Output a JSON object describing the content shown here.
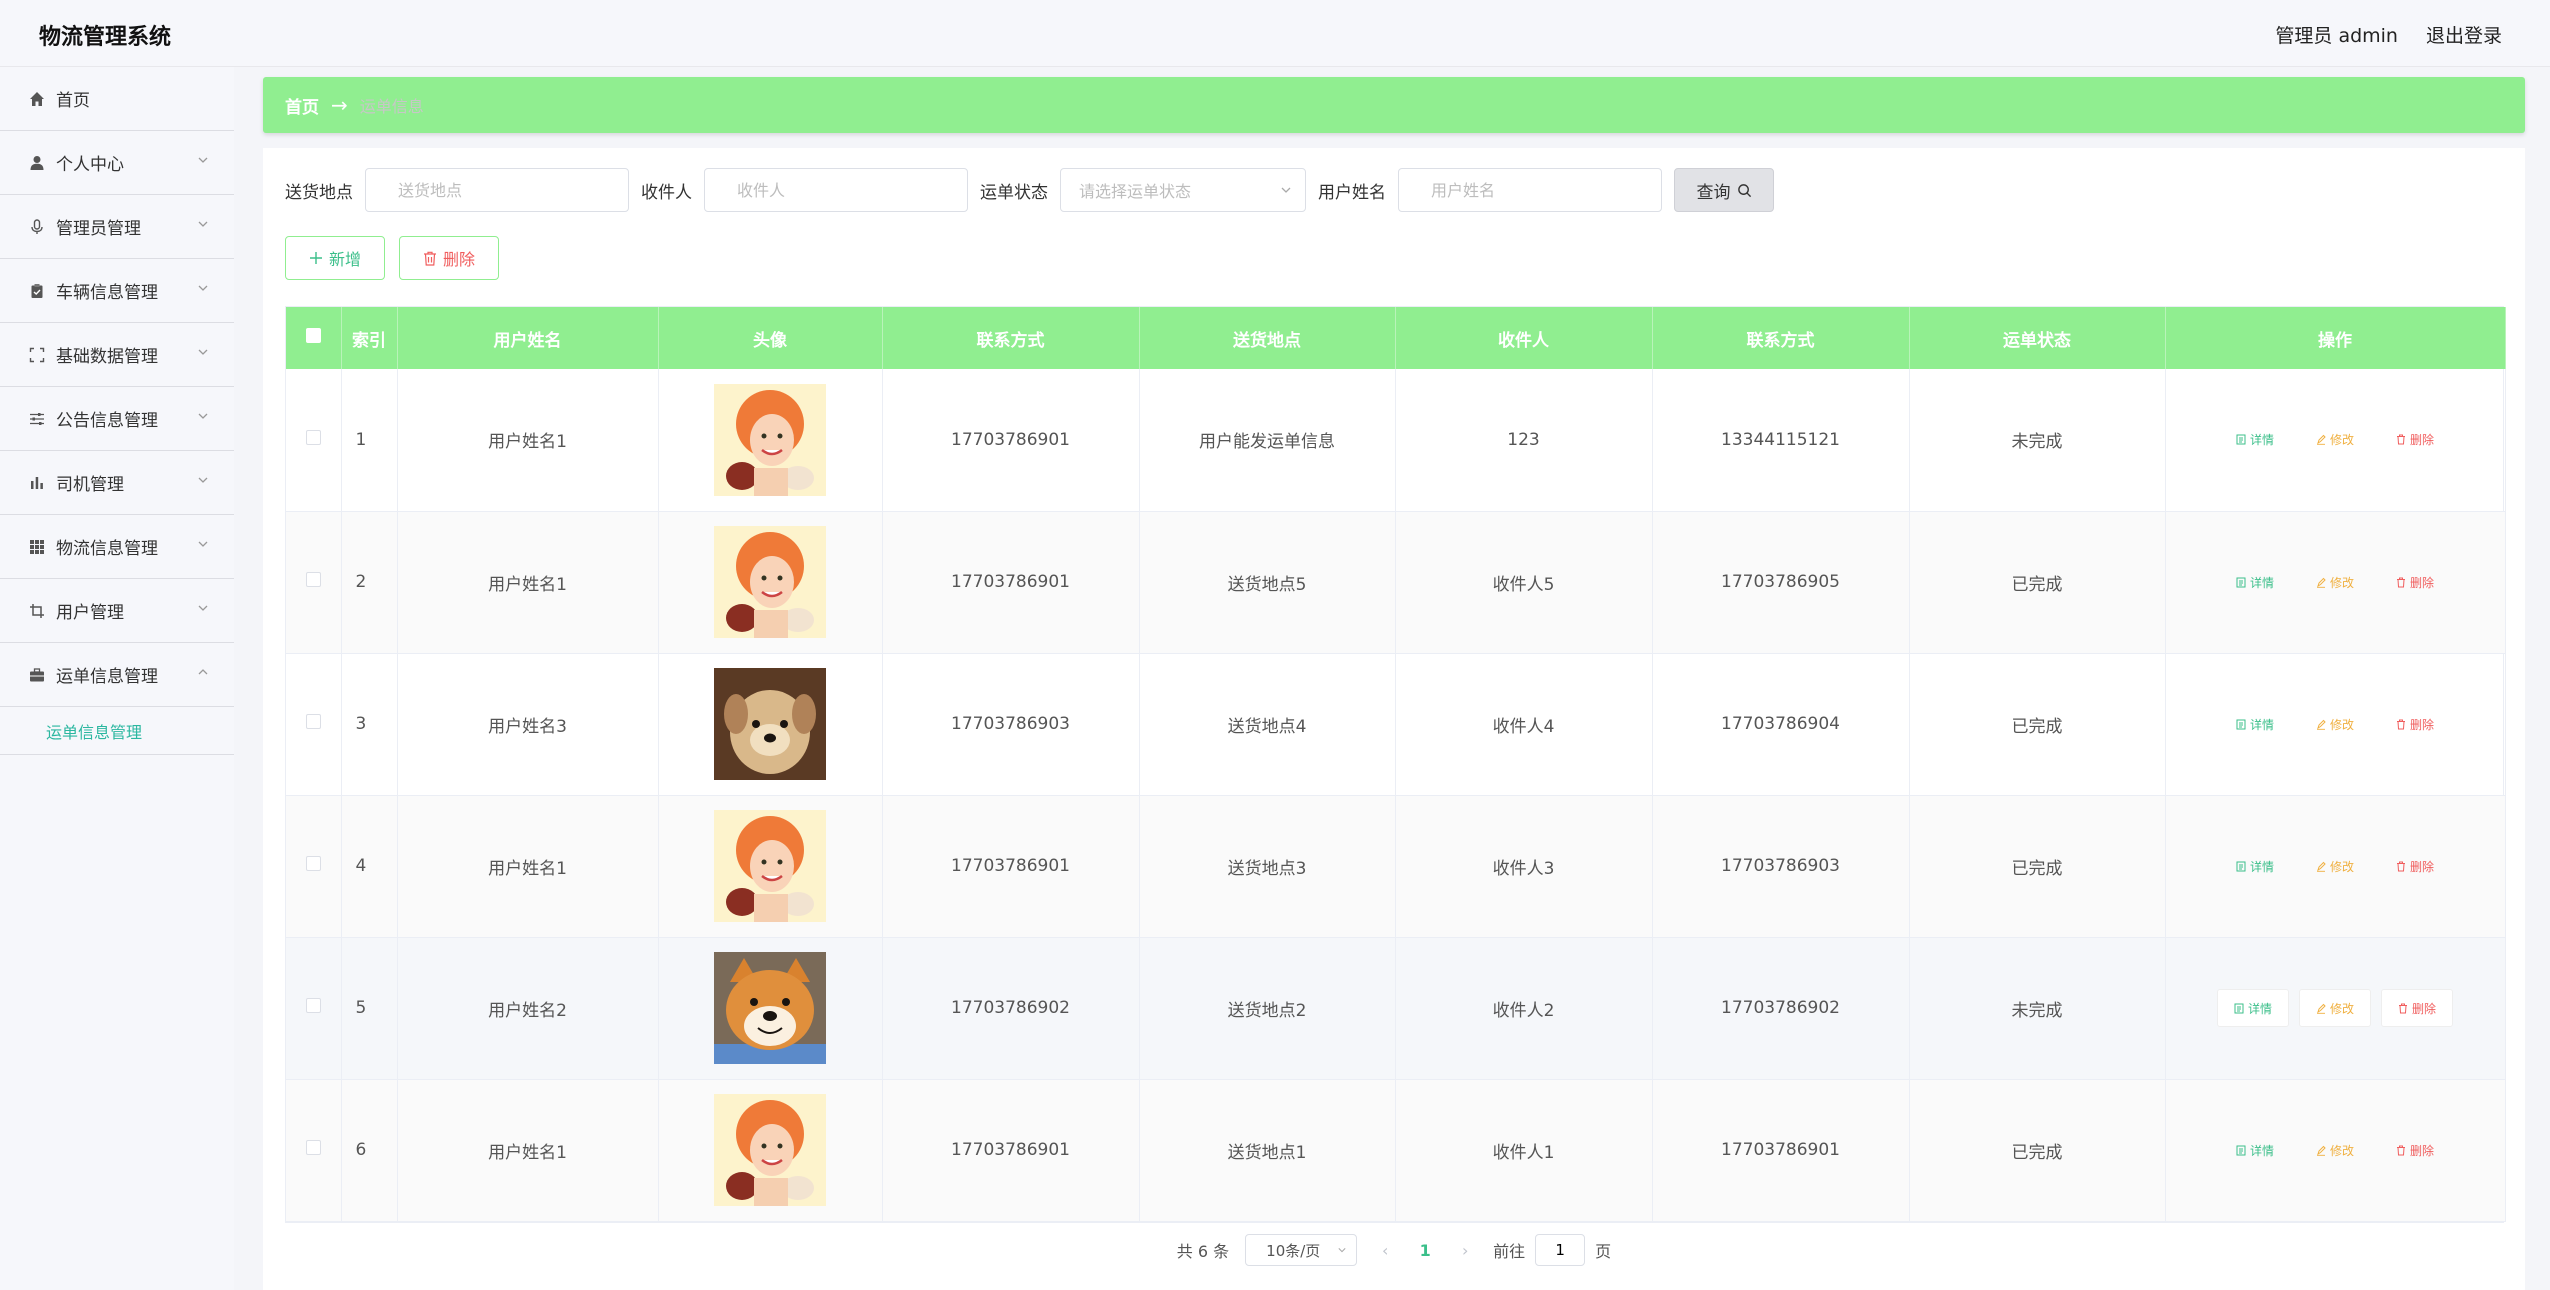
{
  "header": {
    "app_title": "物流管理系统",
    "admin_label": "管理员 admin",
    "logout_label": "退出登录"
  },
  "sidebar": {
    "items": [
      {
        "label": "首页",
        "icon": "home-icon"
      },
      {
        "label": "个人中心",
        "icon": "user-icon"
      },
      {
        "label": "管理员管理",
        "icon": "mic-icon"
      },
      {
        "label": "车辆信息管理",
        "icon": "clipboard-icon"
      },
      {
        "label": "基础数据管理",
        "icon": "fullscreen-icon"
      },
      {
        "label": "公告信息管理",
        "icon": "sliders-icon"
      },
      {
        "label": "司机管理",
        "icon": "bar-chart-icon"
      },
      {
        "label": "物流信息管理",
        "icon": "grid-icon"
      },
      {
        "label": "用户管理",
        "icon": "crop-icon"
      },
      {
        "label": "运单信息管理",
        "icon": "briefcase-icon"
      }
    ],
    "submenu": {
      "label": "运单信息管理"
    }
  },
  "breadcrumb": {
    "home": "首页",
    "arrow": "→",
    "current": "运单信息"
  },
  "search": {
    "address_label": "送货地点",
    "address_placeholder": "送货地点",
    "receiver_label": "收件人",
    "receiver_placeholder": "收件人",
    "status_label": "运单状态",
    "status_placeholder": "请选择运单状态",
    "username_label": "用户姓名",
    "username_placeholder": "用户姓名",
    "query_label": "查询"
  },
  "actions": {
    "add_label": "新增",
    "delete_label": "删除"
  },
  "table": {
    "headers": {
      "index": "索引",
      "username": "用户姓名",
      "avatar": "头像",
      "contact": "联系方式",
      "address": "送货地点",
      "receiver": "收件人",
      "receiver_contact": "联系方式",
      "status": "运单状态",
      "ops": "操作"
    },
    "op_labels": {
      "detail": "详情",
      "edit": "修改",
      "remove": "删除"
    },
    "rows": [
      {
        "index": "1",
        "username": "用户姓名1",
        "avatar": "girl",
        "contact": "17703786901",
        "address": "用户能发运单信息",
        "receiver": "123",
        "receiver_contact": "13344115121",
        "status": "未完成"
      },
      {
        "index": "2",
        "username": "用户姓名1",
        "avatar": "girl",
        "contact": "17703786901",
        "address": "送货地点5",
        "receiver": "收件人5",
        "receiver_contact": "17703786905",
        "status": "已完成"
      },
      {
        "index": "3",
        "username": "用户姓名3",
        "avatar": "puppy",
        "contact": "17703786903",
        "address": "送货地点4",
        "receiver": "收件人4",
        "receiver_contact": "17703786904",
        "status": "已完成"
      },
      {
        "index": "4",
        "username": "用户姓名1",
        "avatar": "girl",
        "contact": "17703786901",
        "address": "送货地点3",
        "receiver": "收件人3",
        "receiver_contact": "17703786903",
        "status": "已完成"
      },
      {
        "index": "5",
        "username": "用户姓名2",
        "avatar": "shiba",
        "contact": "17703786902",
        "address": "送货地点2",
        "receiver": "收件人2",
        "receiver_contact": "17703786902",
        "status": "未完成"
      },
      {
        "index": "6",
        "username": "用户姓名1",
        "avatar": "girl",
        "contact": "17703786901",
        "address": "送货地点1",
        "receiver": "收件人1",
        "receiver_contact": "17703786901",
        "status": "已完成"
      }
    ]
  },
  "pagination": {
    "total": "共 6 条",
    "page_size": "10条/页",
    "current_page": "1",
    "goto_label": "前往",
    "goto_value": "1",
    "page_suffix": "页"
  },
  "colors": {
    "accent_green": "#90ee90",
    "teal": "#3bbf8a",
    "warning": "#f0b040",
    "danger": "#f05d5d"
  }
}
